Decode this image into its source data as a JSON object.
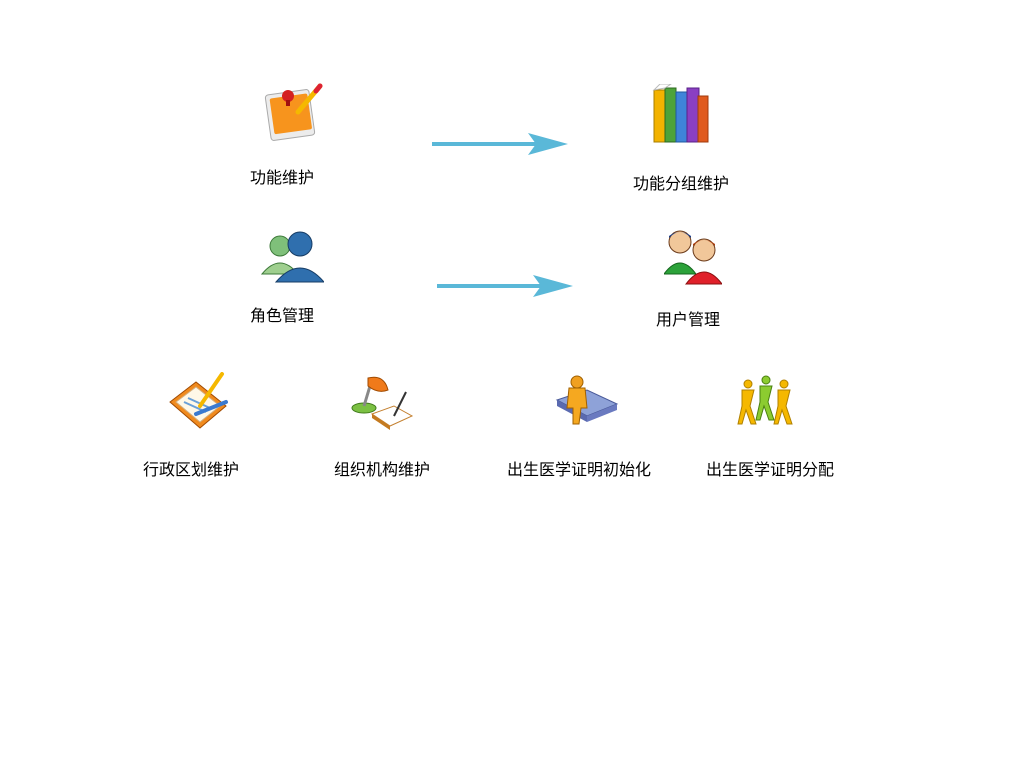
{
  "flow": {
    "func_maintain": "功能维护",
    "func_group_maintain": "功能分组维护",
    "role_manage": "角色管理",
    "user_manage": "用户管理"
  },
  "bottom": {
    "admin_region": "行政区划维护",
    "org_maintain": "组织机构维护",
    "birth_cert_init": "出生医学证明初始化",
    "birth_cert_assign": "出生医学证明分配"
  },
  "icons": {
    "func_maintain": "memo-pin-icon",
    "func_group_maintain": "books-icon",
    "role_manage": "users-icon",
    "user_manage": "two-people-icon",
    "admin_region": "clipboard-pencil-icon",
    "org_maintain": "desk-lamp-book-icon",
    "birth_cert_init": "person-on-book-icon",
    "birth_cert_assign": "people-group-icon"
  },
  "colors": {
    "arrow": "#5ab8d8"
  }
}
